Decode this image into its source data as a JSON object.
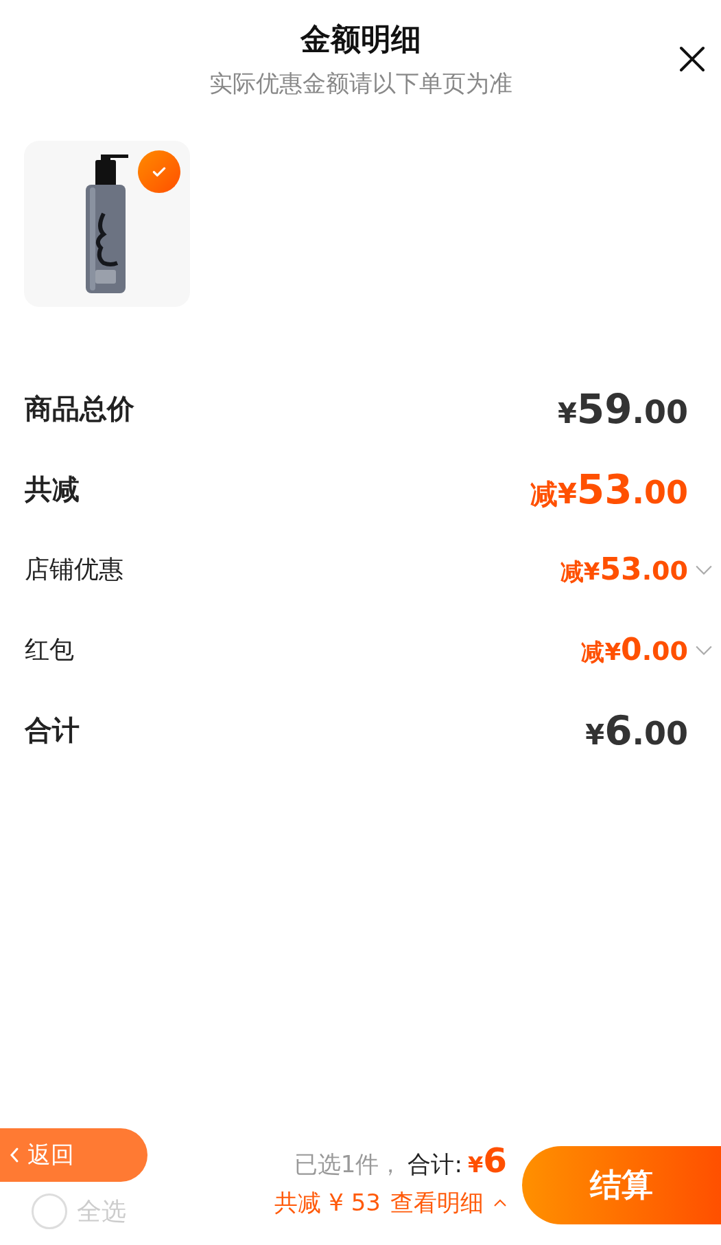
{
  "header": {
    "title": "金额明细",
    "subtitle": "实际优惠金额请以下单页为准"
  },
  "products": [
    {
      "kind": "picture",
      "selected": true
    }
  ],
  "rows": [
    {
      "kind": "total",
      "label": "商品总价",
      "sign": "¥",
      "whole": "59",
      "fraction": ".00"
    },
    {
      "kind": "discount",
      "label": "共减",
      "sign": "减¥",
      "whole": "53",
      "fraction": ".00"
    },
    {
      "kind": "detail",
      "label": "店铺优惠",
      "sign": "减¥",
      "whole": "53",
      "fraction": ".00"
    },
    {
      "kind": "detail",
      "label": "红包",
      "sign": "减¥",
      "whole": "0",
      "fraction": ".00"
    },
    {
      "kind": "total",
      "label": "合计",
      "sign": "¥",
      "whole": "6",
      "fraction": ".00"
    }
  ],
  "footer": {
    "back": "返回",
    "select_all": {
      "label": "全选",
      "checked": false
    },
    "count": "已选1件，",
    "total_label": "合计:",
    "total_sign": "¥",
    "total": "6",
    "discount": "共减 ¥ 53",
    "details": "查看明细",
    "checkout": "结算"
  }
}
